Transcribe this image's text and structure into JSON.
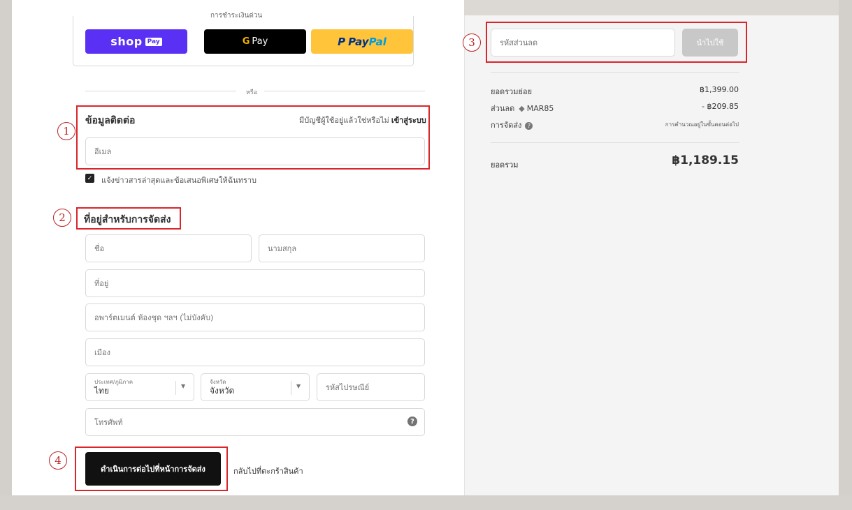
{
  "express": {
    "title": "การชำระเงินด่วน",
    "shop_pay_logo": "shop",
    "shop_pay_tag": "Pay",
    "gpay_g": "G",
    "gpay_label": "Pay",
    "paypal_pay": "Pay",
    "paypal_pal": "Pal",
    "paypal_mark": "P"
  },
  "divider": {
    "label": "หรือ"
  },
  "steps": [
    "1",
    "2",
    "3",
    "4"
  ],
  "contact": {
    "title": "ข้อมูลติดต่อ",
    "login_prompt": "มีบัญชีผู้ใช้อยู่แล้วใช่หรือไม่",
    "login_link": "เข้าสู่ระบบ",
    "email_placeholder": "อีเมล",
    "newsletter_label": "แจ้งข่าวสารล่าสุดและข้อเสนอพิเศษให้ฉันทราบ",
    "newsletter_checked": true
  },
  "shipping": {
    "title": "ที่อยู่สำหรับการจัดส่ง",
    "first_name": "ชื่อ",
    "last_name": "นามสกุล",
    "address": "ที่อยู่",
    "apartment": "อพาร์ตเมนต์ ห้องชุด ฯลฯ (ไม่บังคับ)",
    "city": "เมือง",
    "country_label": "ประเทศ/ภูมิภาค",
    "country_value": "ไทย",
    "province_label": "จังหวัด",
    "province_value": "จังหวัด",
    "postal_code": "รหัสไปรษณีย์",
    "phone": "โทรศัพท์"
  },
  "actions": {
    "continue": "ดำเนินการต่อไปที่หน้าการจัดส่ง",
    "back": "กลับไปที่ตะกร้าสินค้า"
  },
  "summary": {
    "discount_placeholder": "รหัสส่วนลด",
    "apply": "นำไปใช้",
    "subtotal_label": "ยอดรวมย่อย",
    "subtotal_value": "฿1,399.00",
    "discount_label": "ส่วนลด",
    "discount_code": "MAR85",
    "discount_value": "- ฿209.85",
    "shipping_label": "การจัดส่ง",
    "shipping_value": "การคำนวณอยู่ในขั้นตอนต่อไป",
    "total_label": "ยอดรวม",
    "total_value": "฿1,189.15"
  },
  "colors": {
    "highlight": "#d9262c",
    "shop_pay": "#5a31f4",
    "paypal": "#ffc439"
  }
}
